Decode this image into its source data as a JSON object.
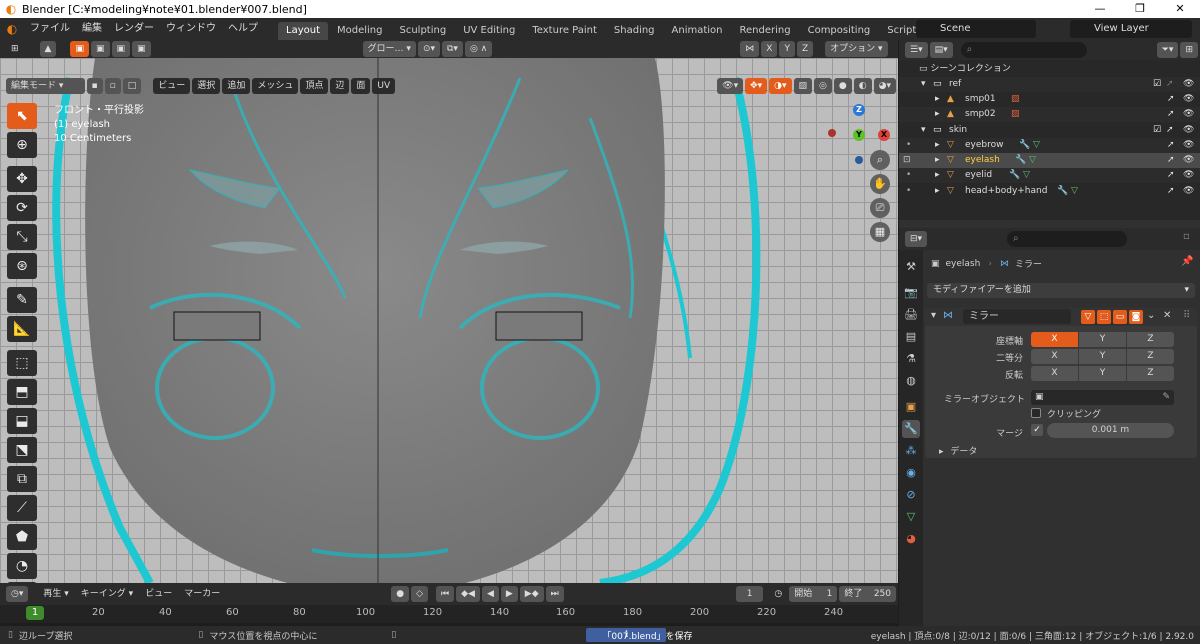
{
  "window": {
    "title": "Blender [C:¥modeling¥note¥01.blender¥007.blend]",
    "controls": [
      "—",
      "❐",
      "✕"
    ]
  },
  "topbar": {
    "menus": [
      "ファイル",
      "編集",
      "レンダー",
      "ウィンドウ",
      "ヘルプ"
    ],
    "workspaces": [
      "Layout",
      "Modeling",
      "Sculpting",
      "UV Editing",
      "Texture Paint",
      "Shading",
      "Animation",
      "Rendering",
      "Compositing",
      "Scripting"
    ],
    "active_workspace": "Layout",
    "add_tab": "+",
    "scene": "Scene",
    "view_layer": "View Layer"
  },
  "viewport": {
    "header": {
      "orientation": "グロー…",
      "mirror_axes": [
        "X",
        "Y",
        "Z"
      ],
      "options": "オプション"
    },
    "mode": "編集モード",
    "menus": [
      "ビュー",
      "選択",
      "追加",
      "メッシュ",
      "頂点",
      "辺",
      "面",
      "UV"
    ],
    "overlay_lines": [
      "フロント・平行投影",
      "(1) eyelash",
      "10 Centimeters"
    ],
    "gizmo": {
      "z": "Z",
      "y": "Y",
      "x": "X"
    }
  },
  "timeline": {
    "header": [
      "再生",
      "キーイング",
      "ビュー",
      "マーカー"
    ],
    "current_frame": "1",
    "start_label": "開始",
    "start": "1",
    "end_label": "終了",
    "end": "250",
    "ticks": [
      "20",
      "40",
      "60",
      "80",
      "100",
      "120",
      "140",
      "160",
      "180",
      "200",
      "220",
      "240"
    ],
    "cursor": "1"
  },
  "outliner": {
    "title": "シーンコレクション",
    "rows": [
      {
        "name": "ref",
        "indent": 1
      },
      {
        "name": "smp01",
        "indent": 2
      },
      {
        "name": "smp02",
        "indent": 2
      },
      {
        "name": "skin",
        "indent": 1
      },
      {
        "name": "eyebrow",
        "indent": 2
      },
      {
        "name": "eyelash",
        "indent": 2
      },
      {
        "name": "eyelid",
        "indent": 2
      },
      {
        "name": "head+body+hand",
        "indent": 2
      }
    ]
  },
  "properties": {
    "breadcrumb_object": "eyelash",
    "breadcrumb_modifier": "ミラー",
    "add_modifier": "モディファイアーを追加",
    "modifier_name": "ミラー",
    "axis_label": "座標軸",
    "bisect_label": "二等分",
    "flip_label": "反転",
    "axes": [
      "X",
      "Y",
      "Z"
    ],
    "mirror_object_label": "ミラーオブジェクト",
    "clipping_label": "クリッピング",
    "merge_label": "マージ",
    "merge_value": "0.001 m",
    "data_label": "データ"
  },
  "statusbar": {
    "left": "辺ループ選択",
    "mid": "マウス位置を視点の中心に",
    "saved": "「007.blend」を保存",
    "stats": "eyelash | 頂点:0/8 | 辺:0/12 | 面:0/6 | 三角面:12 | オブジェクト:1/6 | 2.92.0"
  },
  "colors": {
    "accent": "#e35c1c",
    "cyan": "#1ec8d2",
    "active_text": "#ffd040"
  }
}
